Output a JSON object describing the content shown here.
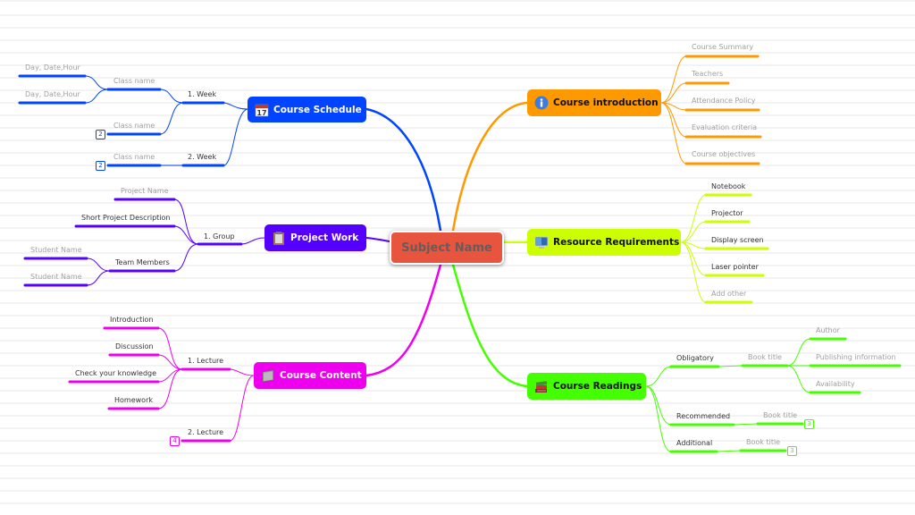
{
  "central_topic": {
    "label": "Subject Name",
    "color": "#e8553f"
  },
  "branches": {
    "course_schedule": {
      "label": "Course Schedule",
      "icon": "calendar-icon",
      "color": "#0044ff",
      "weeks": [
        {
          "label": "1. Week",
          "classes": [
            {
              "label": "Class name",
              "children": [
                "Day, Date,Hour",
                "Day, Date,Hour"
              ]
            },
            {
              "label": "Class name",
              "collapsed_count": "2"
            }
          ]
        },
        {
          "label": "2. Week",
          "classes": [
            {
              "label": "Class name",
              "collapsed_count": "2"
            }
          ]
        }
      ]
    },
    "project_work": {
      "label": "Project Work",
      "icon": "clipboard-icon",
      "color": "#5500ff",
      "group": {
        "label": "1. Group",
        "children": [
          {
            "label": "Project Name"
          },
          {
            "label": "Short Project Description"
          },
          {
            "label": "Team Members",
            "children": [
              "Student Name",
              "Student Name"
            ]
          }
        ]
      }
    },
    "course_content": {
      "label": "Course Content",
      "icon": "folder-icon",
      "color": "#ee00ee",
      "lectures": [
        {
          "label": "1. Lecture",
          "children": [
            "Introduction",
            "Discussion",
            "Check your knowledge",
            "Homework"
          ]
        },
        {
          "label": "2. Lecture",
          "collapsed_count": "4"
        }
      ]
    },
    "course_introduction": {
      "label": "Course introduction",
      "icon": "info-icon",
      "color": "#ff9900",
      "children": [
        "Course Summary",
        "Teachers",
        "Attendance Policy",
        "Evaluation criteria",
        "Course objectives"
      ]
    },
    "resource_requirements": {
      "label": "Resource Requirements",
      "icon": "monitor-icon",
      "color": "#ccff00",
      "children": [
        "Notebook",
        "Projector",
        "Display screen",
        "Laser pointer",
        "Add other"
      ]
    },
    "course_readings": {
      "label": "Course Readings",
      "icon": "books-icon",
      "color": "#44ff00",
      "children": [
        {
          "label": "Obligatory",
          "book": {
            "label": "Book title",
            "children": [
              "Author",
              "Publishing information",
              "Availability"
            ]
          }
        },
        {
          "label": "Recommended",
          "book": {
            "label": "Book title",
            "collapsed_count": "3"
          }
        },
        {
          "label": "Additional",
          "book": {
            "label": "Book title",
            "collapsed_count": "3"
          }
        }
      ]
    }
  }
}
